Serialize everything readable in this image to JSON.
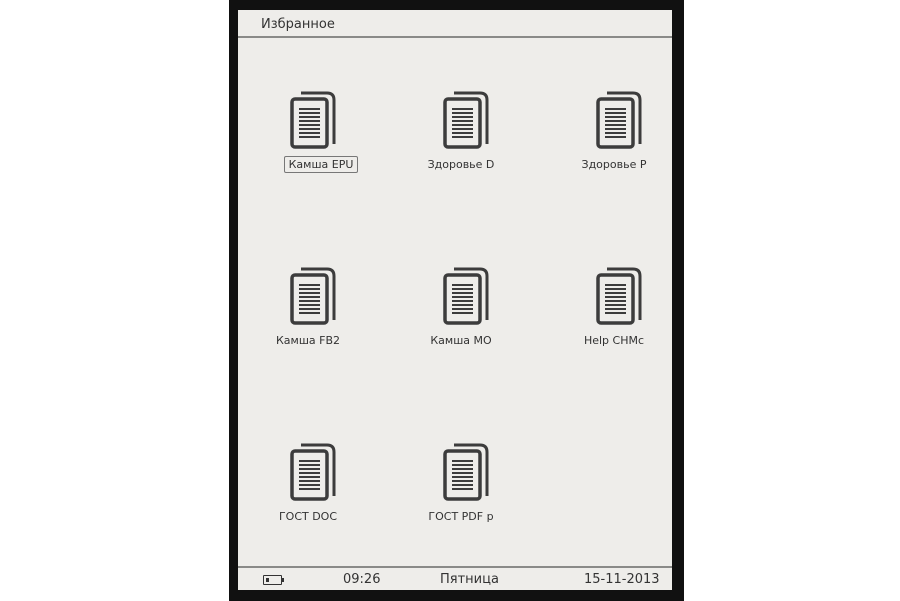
{
  "header": {
    "title": "Избранное"
  },
  "files": [
    {
      "label": "Камша EPU",
      "icon": "documents-icon",
      "selected": true
    },
    {
      "label": "Здоровье D",
      "icon": "documents-icon",
      "selected": false
    },
    {
      "label": "Здоровье P",
      "icon": "documents-icon",
      "selected": false
    },
    {
      "label": "Камша FB2",
      "icon": "documents-icon",
      "selected": false
    },
    {
      "label": "Камша MO",
      "icon": "documents-icon",
      "selected": false
    },
    {
      "label": "Help CHMc",
      "icon": "documents-icon",
      "selected": false
    },
    {
      "label": "ГОСТ DOC",
      "icon": "documents-icon",
      "selected": false
    },
    {
      "label": "ГОСТ PDF p",
      "icon": "documents-icon",
      "selected": false
    }
  ],
  "status_bar": {
    "battery_icon": "battery-icon",
    "time": "09:26",
    "day": "Пятница",
    "date": "15-11-2013"
  }
}
